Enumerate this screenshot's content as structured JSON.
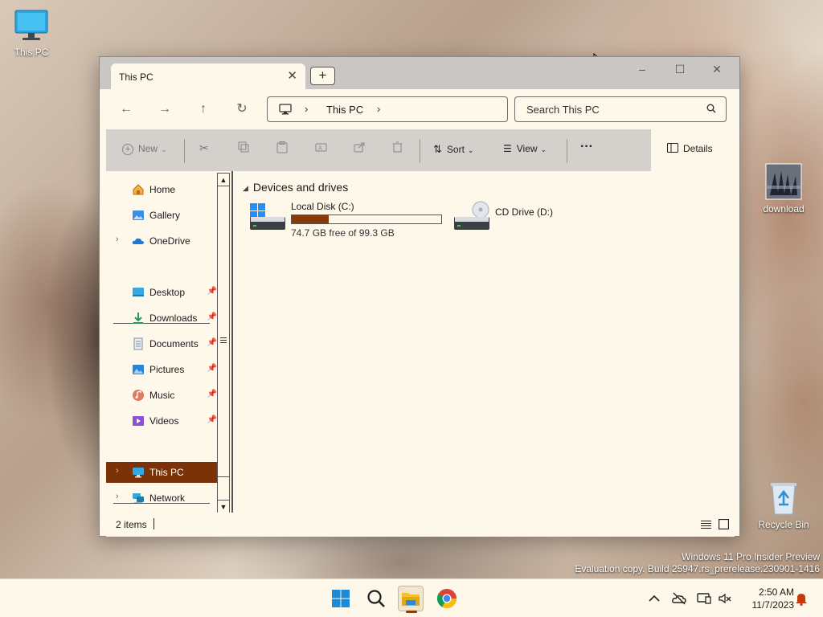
{
  "desktop": {
    "icons": {
      "this_pc": "This PC",
      "download": "download",
      "recycle_bin": "Recycle Bin"
    },
    "watermark": {
      "line1": "Windows 11 Pro Insider Preview",
      "line2": "Evaluation copy. Build 25947.rs_prerelease.230901-1416"
    }
  },
  "explorer": {
    "tab_title": "This PC",
    "new_tab_glyph": "+",
    "window_controls": {
      "minimize": "–",
      "maximize": "☐",
      "close": "✕"
    },
    "address": {
      "crumb": "This PC"
    },
    "search": {
      "placeholder": "Search This PC"
    },
    "commands": {
      "new": "New",
      "sort": "Sort",
      "view": "View",
      "more": "···",
      "details": "Details"
    },
    "sidebar": {
      "home": "Home",
      "gallery": "Gallery",
      "onedrive": "OneDrive",
      "desktop": "Desktop",
      "downloads": "Downloads",
      "documents": "Documents",
      "pictures": "Pictures",
      "music": "Music",
      "videos": "Videos",
      "this_pc": "This PC",
      "network": "Network"
    },
    "content": {
      "group_title": "Devices and drives",
      "drives": [
        {
          "name": "Local Disk (C:)",
          "free_text": "74.7 GB free of 99.3 GB",
          "used_fraction": 0.248
        },
        {
          "name": "CD Drive (D:)"
        }
      ]
    },
    "status": {
      "item_count": "2 items"
    }
  },
  "taskbar": {
    "clock": {
      "time": "2:50 AM",
      "date": "11/7/2023"
    }
  },
  "colors": {
    "accent": "#7b3206",
    "window_bg": "#fdf8ea",
    "toolbar_bg": "#d4d0cb",
    "titlebar_bg": "#c9c6c3"
  }
}
